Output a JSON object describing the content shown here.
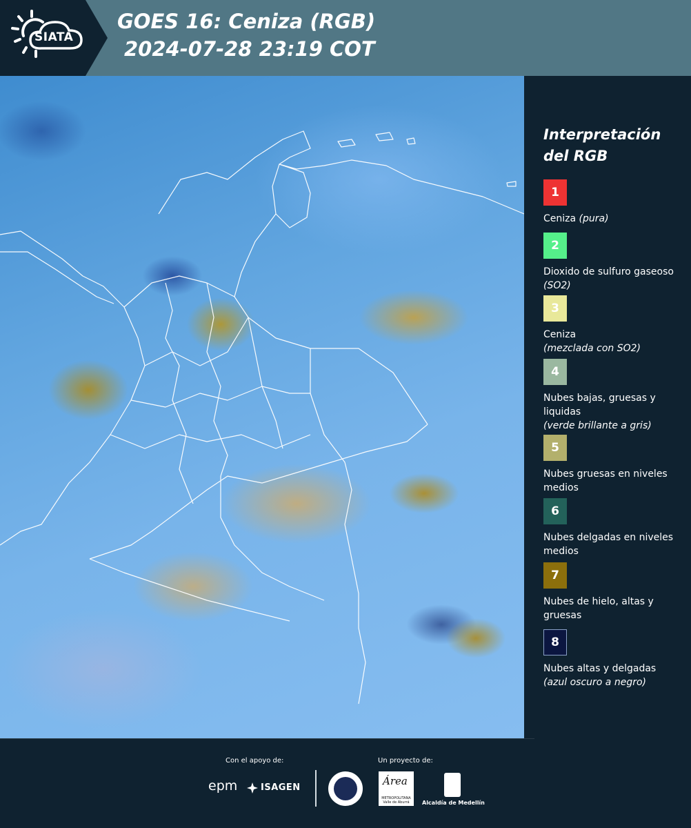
{
  "header": {
    "logo_text": "SIATA",
    "title_line1": "GOES 16: Ceniza (RGB)",
    "title_line2": "2024-07-28 23:19 COT"
  },
  "map": {
    "type": "satellite-rgb-composite",
    "boundary_color": "#ffffff"
  },
  "legend": {
    "title": "Interpretación del RGB",
    "items": [
      {
        "num": "1",
        "label": "Ceniza",
        "note": "(pura)",
        "color": "#ee3333"
      },
      {
        "num": "2",
        "label": "Dioxido de sulfuro gaseoso",
        "note": "(SO2)",
        "color": "#55f08a"
      },
      {
        "num": "3",
        "label": "Ceniza",
        "note": "(mezclada con SO2)",
        "color": "#e8e89a"
      },
      {
        "num": "4",
        "label": "Nubes bajas, gruesas y liquidas",
        "note": "(verde brillante a gris)",
        "color": "#9ab8a0"
      },
      {
        "num": "5",
        "label": "Nubes gruesas en niveles medios",
        "note": "",
        "color": "#b3b06c"
      },
      {
        "num": "6",
        "label": "Nubes delgadas en niveles medios",
        "note": "",
        "color": "#23625a"
      },
      {
        "num": "7",
        "label": "Nubes de hielo, altas y gruesas",
        "note": "",
        "color": "#8c6f0c"
      },
      {
        "num": "8",
        "label": "Nubes altas y delgadas",
        "note": "(azul oscuro a negro)",
        "color": "#0b1640"
      }
    ]
  },
  "footer": {
    "apoyo": "Con el apoyo de:",
    "proyecto": "Un proyecto de:",
    "epm": "epm",
    "isagen": "ISAGEN",
    "area_mark": "Área",
    "area_sub": "METROPOLITANA Valle de Aburrá",
    "alcaldia": "Alcaldía de Medellín"
  }
}
